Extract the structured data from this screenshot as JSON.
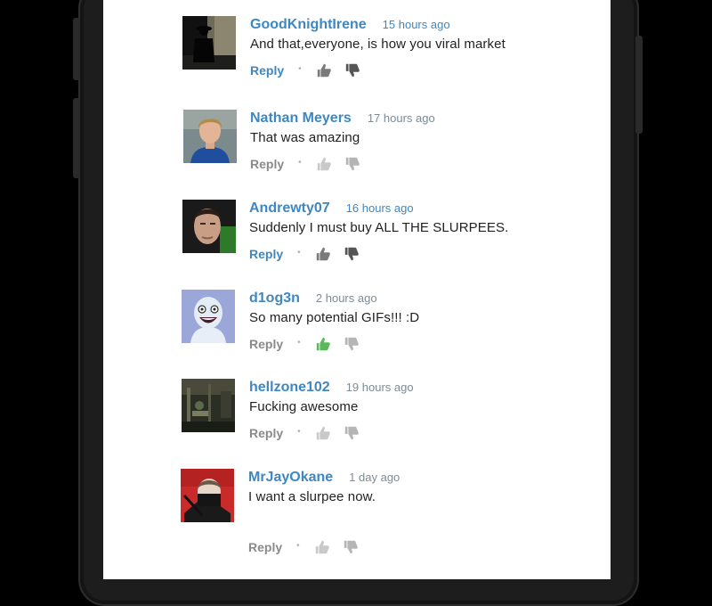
{
  "comments": [
    {
      "username": "GoodKnightIrene",
      "time": "15 hours ago",
      "text": "And that,everyone, is how you viral market",
      "reply": "Reply",
      "active": true,
      "thumb_up_color": "#7a7a7a",
      "avatar": "silhouette-figure-avatar"
    },
    {
      "username": "Nathan Meyers",
      "time": "17 hours ago",
      "text": "That was amazing",
      "reply": "Reply",
      "active": false,
      "thumb_up_color": "#c9c9c9",
      "avatar": "young-man-avatar"
    },
    {
      "username": "Andrewty07",
      "time": "16 hours ago",
      "text": "Suddenly I must buy ALL THE SLURPEES.",
      "reply": "Reply",
      "active": true,
      "thumb_up_color": "#7a7a7a",
      "avatar": "man-portrait-avatar"
    },
    {
      "username": "d1og3n",
      "time": "2 hours ago",
      "text": "So many potential GIFs!!! :D",
      "reply": "Reply",
      "active": false,
      "thumb_up_color": "#5cb85c",
      "avatar": "cartoon-face-avatar"
    },
    {
      "username": "hellzone102",
      "time": "19 hours ago",
      "text": "Fucking awesome",
      "reply": "Reply",
      "active": false,
      "thumb_up_color": "#c9c9c9",
      "avatar": "dark-scene-avatar"
    },
    {
      "username": "MrJayOkane",
      "time": "1 day ago",
      "text": "I want a slurpee now.",
      "reply": "Reply",
      "active": false,
      "thumb_up_color": "#c9c9c9",
      "avatar": "masked-man-avatar"
    }
  ],
  "colors": {
    "link": "#3f87c1",
    "muted": "#8a8a8a",
    "liked": "#5cb85c"
  }
}
